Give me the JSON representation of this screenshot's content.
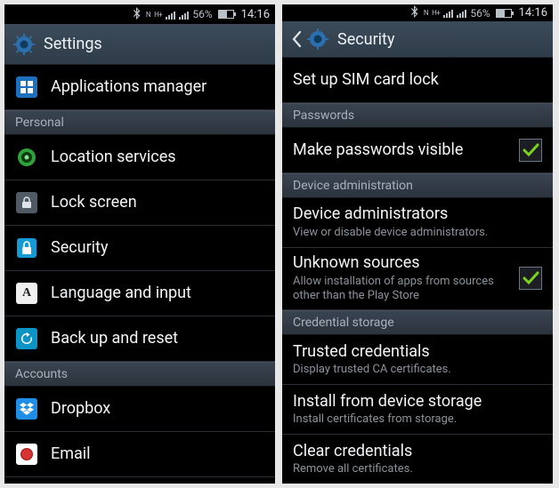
{
  "status": {
    "battery_pct": "56%",
    "time": "14:16",
    "net1": "N",
    "net2": "H+"
  },
  "left": {
    "title": "Settings",
    "rows": [
      {
        "kind": "item",
        "icon": "apps-icon",
        "label": "Applications manager"
      },
      {
        "kind": "section",
        "label": "Personal"
      },
      {
        "kind": "item",
        "icon": "location-icon",
        "label": "Location services"
      },
      {
        "kind": "item",
        "icon": "lock-icon",
        "label": "Lock screen"
      },
      {
        "kind": "item",
        "icon": "security-icon",
        "label": "Security"
      },
      {
        "kind": "item",
        "icon": "language-icon",
        "label": "Language and input",
        "glyph": "A"
      },
      {
        "kind": "item",
        "icon": "backup-icon",
        "label": "Back up and reset"
      },
      {
        "kind": "section",
        "label": "Accounts"
      },
      {
        "kind": "item",
        "icon": "dropbox-icon",
        "label": "Dropbox"
      },
      {
        "kind": "item",
        "icon": "email-icon",
        "label": "Email"
      }
    ]
  },
  "right": {
    "title": "Security",
    "rows": [
      {
        "kind": "item",
        "label": "Set up SIM card lock"
      },
      {
        "kind": "section",
        "label": "Passwords"
      },
      {
        "kind": "item",
        "label": "Make passwords visible",
        "checkbox": true,
        "checked": true
      },
      {
        "kind": "section",
        "label": "Device administration"
      },
      {
        "kind": "item",
        "label": "Device administrators",
        "sub": "View or disable device administrators."
      },
      {
        "kind": "item",
        "label": "Unknown sources",
        "sub": "Allow installation of apps from sources other than the Play Store",
        "checkbox": true,
        "checked": true
      },
      {
        "kind": "section",
        "label": "Credential storage"
      },
      {
        "kind": "item",
        "label": "Trusted credentials",
        "sub": "Display trusted CA certificates."
      },
      {
        "kind": "item",
        "label": "Install from device storage",
        "sub": "Install certificates from storage."
      },
      {
        "kind": "item",
        "label": "Clear credentials",
        "sub": "Remove all certificates."
      }
    ]
  }
}
